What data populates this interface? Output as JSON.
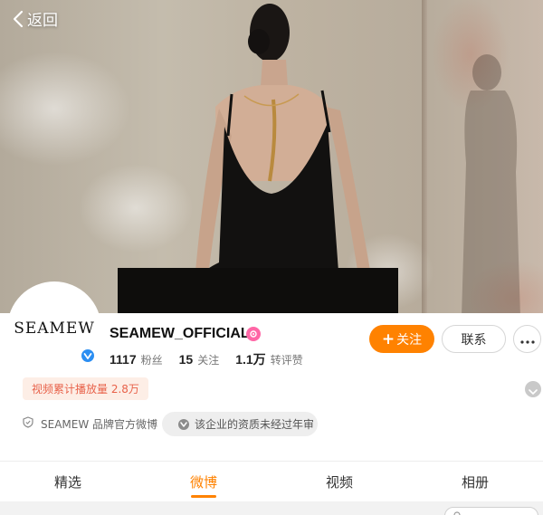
{
  "nav": {
    "back_label": "返回"
  },
  "profile": {
    "avatar_text": "SEAMEW",
    "name": "SEAMEW_OFFICIAL",
    "stats": [
      {
        "value": "1117",
        "label": "粉丝"
      },
      {
        "value": "15",
        "label": "关注"
      },
      {
        "value": "1.1万",
        "label": "转评赞"
      }
    ],
    "follow_label": "关注",
    "contact_label": "联系",
    "play_count_tag": "视频累计播放量 2.8万",
    "official_desc": "SEAMEW 品牌官方微博",
    "cert_notice": "该企业的资质未经过年审"
  },
  "tabs": [
    {
      "label": "精选",
      "active": false
    },
    {
      "label": "微博",
      "active": true
    },
    {
      "label": "视频",
      "active": false
    },
    {
      "label": "相册",
      "active": false
    }
  ],
  "colors": {
    "accent": "#ff8200",
    "tag_text": "#e8624a",
    "verify_blue": "#2b8ef2"
  },
  "icons": [
    "back-arrow-icon",
    "verified-icon",
    "vip-icon",
    "plus-icon",
    "more-dots-icon",
    "chevron-down-icon",
    "shield-icon",
    "info-dot-icon",
    "search-icon"
  ]
}
